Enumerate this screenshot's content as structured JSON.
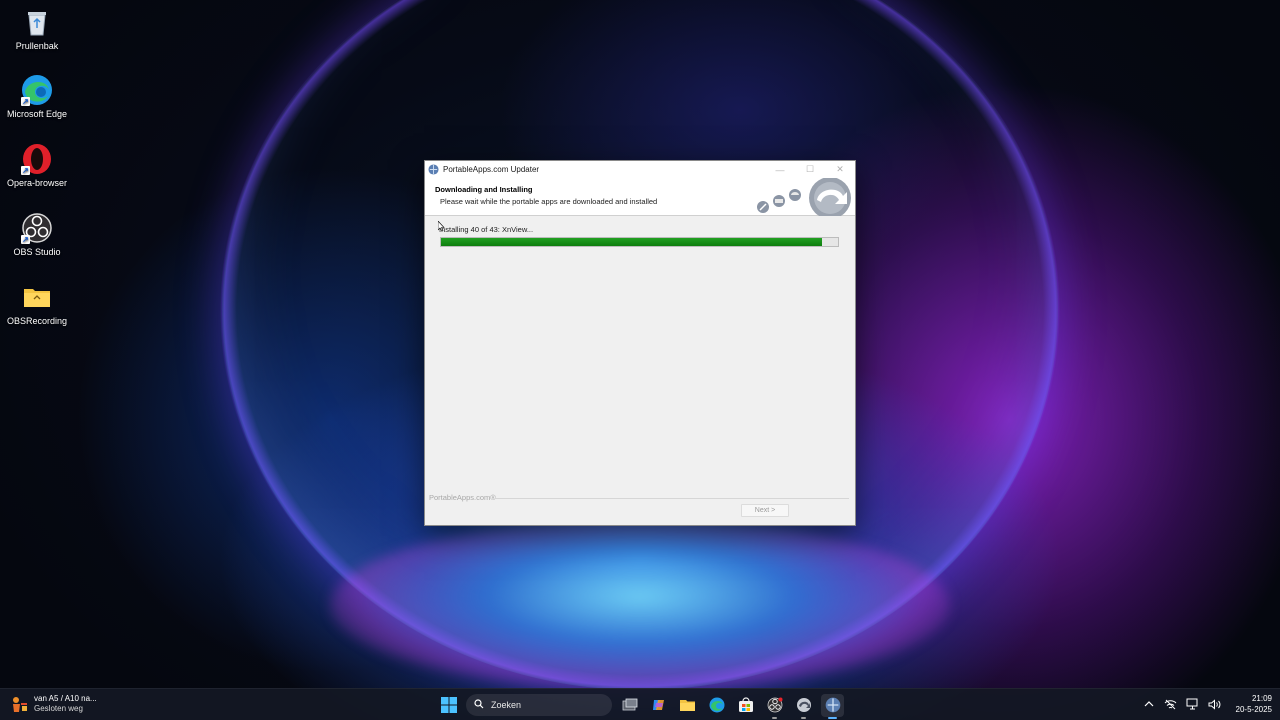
{
  "desktop": {
    "icons": [
      {
        "label": "Prullenbak",
        "icon": "recycle-bin-icon"
      },
      {
        "label": "Microsoft Edge",
        "icon": "edge-icon"
      },
      {
        "label": "Opera-browser",
        "icon": "opera-icon"
      },
      {
        "label": "OBS Studio",
        "icon": "obs-icon"
      },
      {
        "label": "OBSRecording",
        "icon": "folder-icon"
      }
    ]
  },
  "window": {
    "title": "PortableApps.com Updater",
    "header_title": "Downloading and Installing",
    "header_subtitle": "Please wait while the portable apps are downloaded and installed",
    "status": "Installing 40 of 43: XnView...",
    "progress_percent": 96,
    "brand": "PortableApps.com®",
    "next_label": "Next >",
    "controls": {
      "minimize": "—",
      "maximize": "☐",
      "close": "✕"
    }
  },
  "taskbar": {
    "news_line1": "van A5 / A10 na...",
    "news_line2": "Gesloten weg",
    "search_placeholder": "Zoeken",
    "time": "21:09",
    "date": "20-5-2025",
    "accent": "#5cb3ff"
  }
}
